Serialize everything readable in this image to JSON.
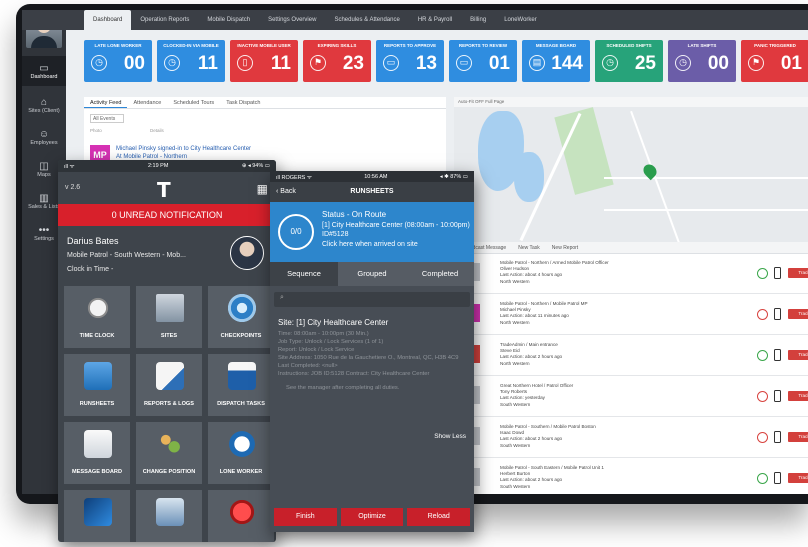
{
  "topnav": {
    "tabs": [
      "Dashboard",
      "Operation Reports",
      "Mobile Dispatch",
      "Settings Overview",
      "Schedules & Attendance",
      "HR & Payroll",
      "Billing",
      "LoneWorker"
    ],
    "active_index": 0
  },
  "sidebar": {
    "items": [
      {
        "label": "Dashboard",
        "icon": "monitor-icon"
      },
      {
        "label": "Sites (Client)",
        "icon": "building-icon"
      },
      {
        "label": "Employees",
        "icon": "people-icon"
      },
      {
        "label": "Maps",
        "icon": "map-icon"
      },
      {
        "label": "Sales & Lists",
        "icon": "chart-icon"
      },
      {
        "label": "Settings",
        "icon": "dots-icon"
      }
    ]
  },
  "tiles": [
    {
      "label": "LATE LONE WORKER",
      "value": "00",
      "color": "#2f8de0"
    },
    {
      "label": "CLOCKED-IN VIA MOBILE",
      "value": "11",
      "color": "#2f8de0"
    },
    {
      "label": "INACTIVE MOBILE USER",
      "value": "11",
      "color": "#e0393e"
    },
    {
      "label": "EXPIRING SKILLS",
      "value": "23",
      "color": "#e0393e"
    },
    {
      "label": "REPORTS TO APPROVE",
      "value": "13",
      "color": "#2f8de0"
    },
    {
      "label": "REPORTS TO REVIEW",
      "value": "01",
      "color": "#2f8de0"
    },
    {
      "label": "MESSAGE BOARD",
      "value": "144",
      "color": "#2f8de0"
    },
    {
      "label": "SCHEDULED SHIFTS",
      "value": "25",
      "color": "#27a37a"
    },
    {
      "label": "LATE SHIFTS",
      "value": "00",
      "color": "#6b5da8"
    },
    {
      "label": "PANIC TRIGGERED",
      "value": "01",
      "color": "#e0393e"
    }
  ],
  "feed": {
    "tabs": [
      "Activity Feed",
      "Attendance",
      "Scheduled Tours",
      "Task Dispatch"
    ],
    "filter": "All Events",
    "headers": [
      "Photo",
      "Details"
    ],
    "item": {
      "initials": "MP",
      "line1": "Michael Pinsky signed-in to City Healthcare Center",
      "line2": "At Mobile Patrol - Northern"
    }
  },
  "map": {
    "toolbar": "Auto-Fit OFF   Full Page"
  },
  "list": {
    "tabs": [
      "Broadcast Message",
      "New Task",
      "New Report"
    ],
    "rows": [
      {
        "lines": [
          "Mobile Patrol - Northern / Armed Mobile Patrol Officer",
          "Oliver Hudson",
          "Last Action: about 4 hours ago",
          "North Western"
        ],
        "color": "#c7cacf",
        "clock": "green"
      },
      {
        "lines": [
          "Mobile Patrol - Northern / Mobile Patrol MP",
          "Michael Pinsky",
          "Last Action: about 11 minutes ago",
          "North Western"
        ],
        "color": "#d632b4",
        "clock": "red"
      },
      {
        "lines": [
          "TradeAdmin / Main entrance",
          "Steve Eid",
          "Last Action: about 2 hours ago",
          "North Western"
        ],
        "color": "#d8433f",
        "clock": "green"
      },
      {
        "lines": [
          "Great Northern Hotel / Patrol Officer",
          "Tony Roberts",
          "Last Action: yesterday",
          "South Western"
        ],
        "color": "#c7cacf",
        "clock": "red"
      },
      {
        "lines": [
          "Mobile Patrol - Southern / Mobile Patrol Boston",
          "Isaac Dowd",
          "Last Action: about 2 hours ago",
          "South Western"
        ],
        "color": "#c7cacf",
        "clock": "red"
      },
      {
        "lines": [
          "Mobile Patrol - South Eastern / Mobile Patrol Unit 1",
          "Herbert Burton",
          "Last Action: about 2 hours ago",
          "South Western"
        ],
        "color": "#c7cacf",
        "clock": "green"
      }
    ],
    "track_label": "Track"
  },
  "phone1": {
    "status": {
      "left": "ıll ᯤ",
      "time": "2:19 PM",
      "right": "⊕ ◂ 94% ▭"
    },
    "version": "v 2.6",
    "logo": "T",
    "unread": "0 UNREAD NOTIFICATION",
    "user": {
      "name": "Darius Bates",
      "sub": "Mobile Patrol - South Western - Mob...",
      "clockin": "Clock in Time -"
    },
    "tiles": [
      {
        "label": "TIME CLOCK",
        "icon": "stopwatch-icon"
      },
      {
        "label": "SITES",
        "icon": "building-icon"
      },
      {
        "label": "CHECKPOINTS",
        "icon": "target-icon"
      },
      {
        "label": "RUNSHEETS",
        "icon": "clipboard-icon"
      },
      {
        "label": "REPORTS & LOGS",
        "icon": "notebook-icon"
      },
      {
        "label": "DISPATCH TASKS",
        "icon": "checkbox-icon"
      },
      {
        "label": "MESSAGE BOARD",
        "icon": "envelope-icon"
      },
      {
        "label": "CHANGE POSITION",
        "icon": "group-icon"
      },
      {
        "label": "LONE WORKER",
        "icon": "document-icon"
      },
      {
        "label": "",
        "icon": "tablet-icon"
      },
      {
        "label": "",
        "icon": "badge-icon"
      },
      {
        "label": "",
        "icon": "panic-button-icon"
      }
    ]
  },
  "phone2": {
    "status": {
      "left": "ıll ROGERS ᯤ",
      "time": "10:56 AM",
      "right": "◂ ✱ 87% ▭"
    },
    "back": "Back",
    "title": "RUNSHEETS",
    "progress": "0/0",
    "status_title": "Status - On Route",
    "status_detail": "[1] City Healthcare Center (08:00am - 10:00pm) ID#5128",
    "status_link": "Click here when arrived on site",
    "segments": [
      "Sequence",
      "Grouped",
      "Completed"
    ],
    "search_icon": "⌕",
    "site": {
      "title": "Site: [1] City Healthcare Center",
      "lines": [
        "Time: 08:00am - 10:00pm (30 Min.)",
        "Job Type: Unlock / Lock Services (1 of 1)",
        "Report: Unlock / Lock Service",
        "Site Address: 1050 Rue de la Gauchetiere O., Montreal, QC, H3B 4C9",
        "Last Completed: <null>",
        "Instructions: JOB ID:5128 Contract: City Healthcare Center"
      ],
      "note": "See the manager after completing all duties."
    },
    "show_less": "Show Less",
    "actions": [
      "Finish",
      "Optimize",
      "Reload"
    ]
  }
}
